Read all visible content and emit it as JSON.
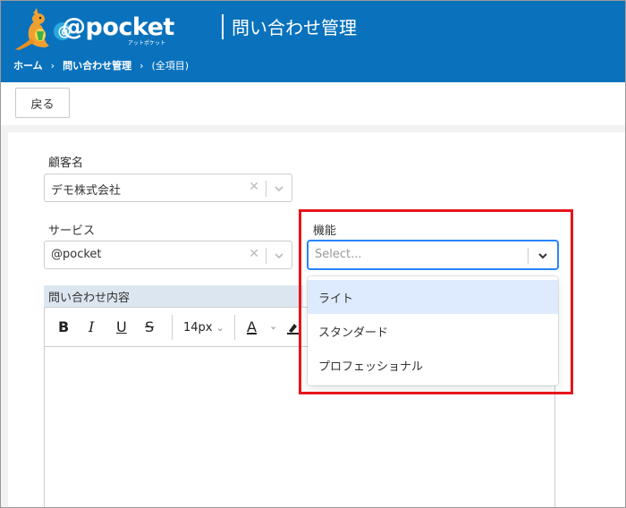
{
  "header": {
    "logo_text": "@pocket",
    "logo_sub": "アットポケット",
    "app_title": "問い合わせ管理"
  },
  "breadcrumb": {
    "home": "ホーム",
    "section": "問い合わせ管理",
    "current": "(全項目)",
    "separator": "›"
  },
  "toolbar": {
    "back_label": "戻る"
  },
  "form": {
    "customer": {
      "label": "顧客名",
      "value": "デモ株式会社"
    },
    "service": {
      "label": "サービス",
      "value": "@pocket"
    },
    "feature": {
      "label": "機能",
      "placeholder": "Select...",
      "options": [
        "ライト",
        "スタンダード",
        "プロフェッショナル"
      ],
      "focused_index": 0
    },
    "inquiry": {
      "label": "問い合わせ内容",
      "font_size": "14px"
    }
  },
  "colors": {
    "header_bg": "#0a72bd",
    "highlight": "#e8141c",
    "focus": "#2684ff",
    "option_focus": "#deebff"
  }
}
